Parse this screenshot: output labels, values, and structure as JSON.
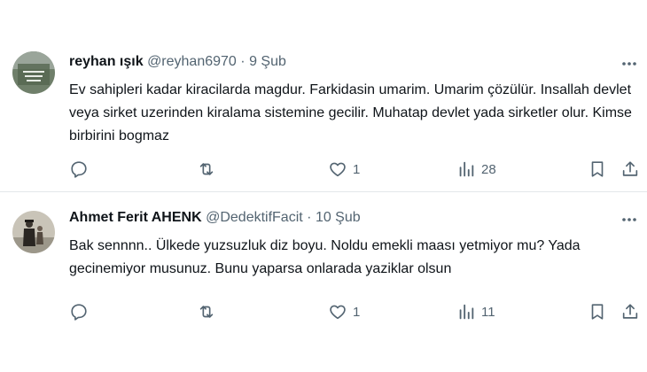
{
  "tweets": [
    {
      "name": "reyhan ışık",
      "handle": "@reyhan6970",
      "separator": "·",
      "date": "9 Şub",
      "text": "Ev sahipleri kadar kiracilarda magdur. Farkidasin umarim. Umarim çözülür. Insallah devlet veya sirket uzerinden kiralama sistemine gecilir. Muhatap devlet yada sirketler olur. Kimse birbirini bogmaz",
      "replies": "",
      "retweets": "",
      "likes": "1",
      "views": "28"
    },
    {
      "name": "Ahmet Ferit AHENK",
      "handle": "@DedektifFacit",
      "separator": "·",
      "date": "10 Şub",
      "text": "Bak sennnn.. Ülkede yuzsuzluk diz boyu. Noldu emekli maası yetmiyor mu? Yada gecinemiyor musunuz. Bunu yaparsa onlarada yaziklar olsun",
      "replies": "",
      "retweets": "",
      "likes": "1",
      "views": "11"
    }
  ],
  "icons": {
    "more": "more-icon",
    "reply": "reply-icon",
    "retweet": "retweet-icon",
    "like": "heart-icon",
    "views": "views-icon",
    "bookmark": "bookmark-icon",
    "share": "share-icon"
  },
  "colors": {
    "text": "#0f1419",
    "secondary": "#536471",
    "divider": "#e3e7ea"
  }
}
